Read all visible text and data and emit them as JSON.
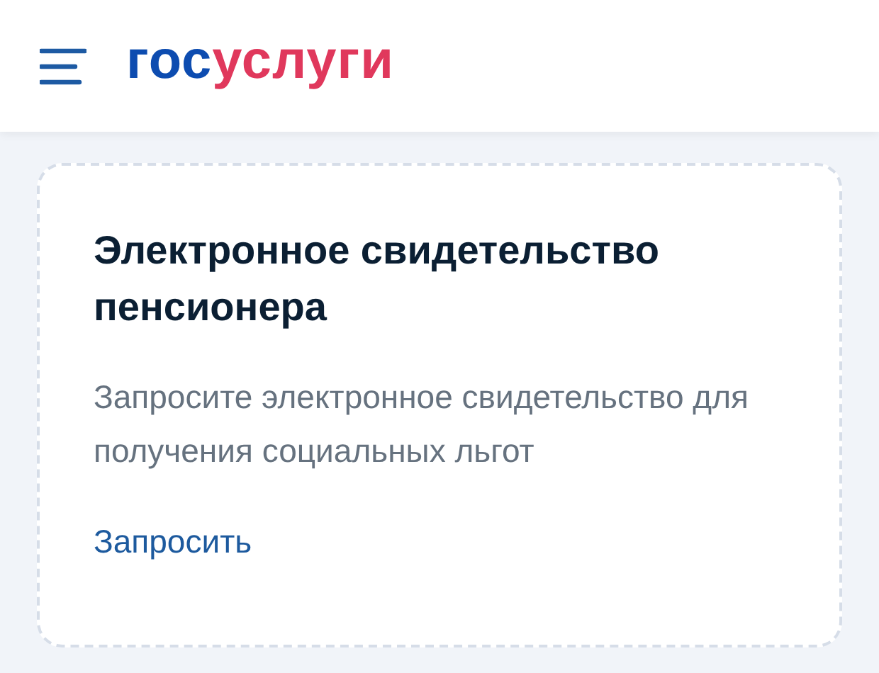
{
  "header": {
    "logo": {
      "part_1": "гос",
      "part_2": "услуги"
    }
  },
  "card": {
    "title": "Электронное свидетельство пенсионера",
    "description": "Запросите электронное свидетельство для получения социальных льгот",
    "link": "Запросить"
  }
}
